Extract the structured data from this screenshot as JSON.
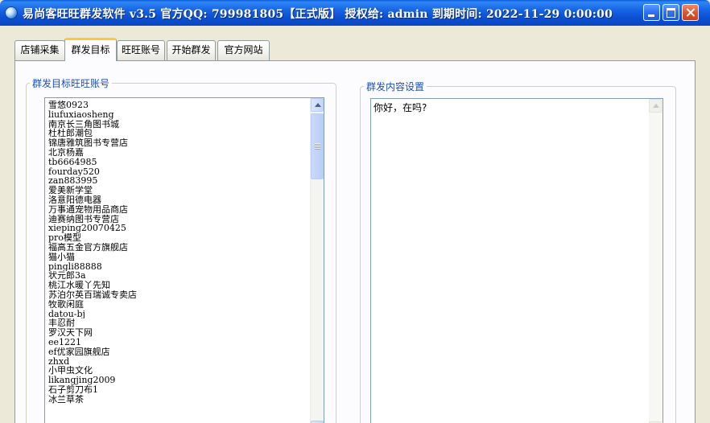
{
  "window": {
    "title": "易尚客旺旺群发软件 v3.5 官方QQ: 799981805【正式版】 授权给: admin  到期时间: 2022-11-29 0:00:00"
  },
  "tabs": [
    {
      "label": "店铺采集"
    },
    {
      "label": "群发目标"
    },
    {
      "label": "旺旺账号"
    },
    {
      "label": "开始群发"
    },
    {
      "label": "官方网站"
    }
  ],
  "targets": {
    "group_label": "群发目标旺旺账号",
    "accounts": [
      "雪悠0923",
      "liufuxiaosheng",
      "南京长三角图书城",
      "杜杜郎潮包",
      "锦唐雅筑图书专营店",
      "北京杨嘉",
      "tb6664985",
      "fourday520",
      "zan883995",
      "爱美新学堂",
      "洛意阳德电器",
      "万事通宠物用品商店",
      "迪赛纳图书专营店",
      "xieping20070425",
      "pro模型",
      "福高五金官方旗舰店",
      "猫小猫",
      "pingli88888",
      "状元郎3a",
      "桃江水暖丫先知",
      "苏泊尔英百瑞诚专卖店",
      "牧歌闲庭",
      "datou-bj",
      "丰忍耐",
      "罗汉天下网",
      "ee1221",
      "ef优家园旗舰店",
      "zhxd",
      "小甲虫文化",
      "likangjing2009",
      "石子剪刀布1",
      "冰兰草茶"
    ]
  },
  "content": {
    "group_label": "群发内容设置",
    "message": "你好，在吗?"
  },
  "colors": {
    "titlebar": "#0b4fd0",
    "tab_highlight": "#ffc83c",
    "group_label": "#1a4fb8",
    "panel_bg": "#fcfcfe"
  },
  "icons": {
    "app": "app-icon",
    "minimize": "minimize-icon",
    "maximize": "maximize-icon",
    "close": "close-icon",
    "scroll_up": "arrow-up-icon",
    "scroll_down": "arrow-down-icon"
  }
}
